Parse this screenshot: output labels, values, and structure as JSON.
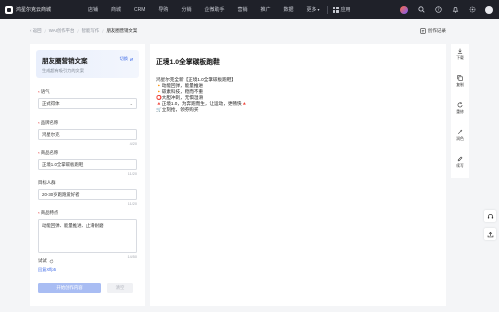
{
  "topnav": {
    "brand": "鸿星尔克云商城",
    "items": [
      {
        "label": "店铺"
      },
      {
        "label": "商城"
      },
      {
        "label": "CRM"
      },
      {
        "label": "导购"
      },
      {
        "label": "分销"
      },
      {
        "label": "企微助手"
      },
      {
        "label": "营销"
      },
      {
        "label": "推广"
      },
      {
        "label": "数据"
      },
      {
        "label": "更多"
      }
    ],
    "apps_label": "应用"
  },
  "breadcrumb": {
    "items": [
      "返回",
      "WAI创作平台",
      "智能写作"
    ],
    "current": "朋友圈营销文案",
    "record_label": "创作记录"
  },
  "form": {
    "card_title": "朋友圈营销文案",
    "card_desc": "生成超有吸引力的文案",
    "switch_label": "切换",
    "tone_label": "语气",
    "tone_value": "正式得体",
    "brand_label": "品牌名称",
    "brand_value": "鸿星尔克",
    "brand_count": "4/20",
    "product_label": "商品名称",
    "product_value": "正境1.0全掌碳板跑鞋",
    "product_count": "11/20",
    "audience_label": "目标人群",
    "audience_value": "20-30岁跑跑爱好者",
    "audience_count": "11/20",
    "feature_label": "商品特点",
    "feature_value": "动能回弹、能量推进、止滑耐磨",
    "feature_count": "14/50",
    "keyword_label": "试试",
    "keyword_tag": "回复Xffp5",
    "generate_label": "开始创作内容",
    "reset_label": "清空"
  },
  "result": {
    "title": "正境1.0全掌碳板跑鞋",
    "lines": [
      "鸿星尔克全新【正境1.0全掌碳板跑鞋】",
      "🔸动能回弹，能量推进",
      "🔸碳素科技，稳而不重",
      "⭕大胆冲刺，无惧湿滑",
      "🔺正境1.0，为奔跑而生，让运动，更畅快🔺",
      "🛒立刻抢，领券购买"
    ]
  },
  "toolbar": {
    "items": [
      {
        "label": "下载",
        "icon": "download-icon"
      },
      {
        "label": "复制",
        "icon": "copy-icon"
      },
      {
        "label": "重修",
        "icon": "refresh-icon"
      },
      {
        "label": "润色",
        "icon": "polish-icon"
      },
      {
        "label": "续写",
        "icon": "continue-icon"
      }
    ]
  },
  "colors": {
    "nav_bg": "#1f2129",
    "accent": "#3f6be8",
    "button_disabled": "#a9bdf3",
    "required": "#e54545"
  }
}
